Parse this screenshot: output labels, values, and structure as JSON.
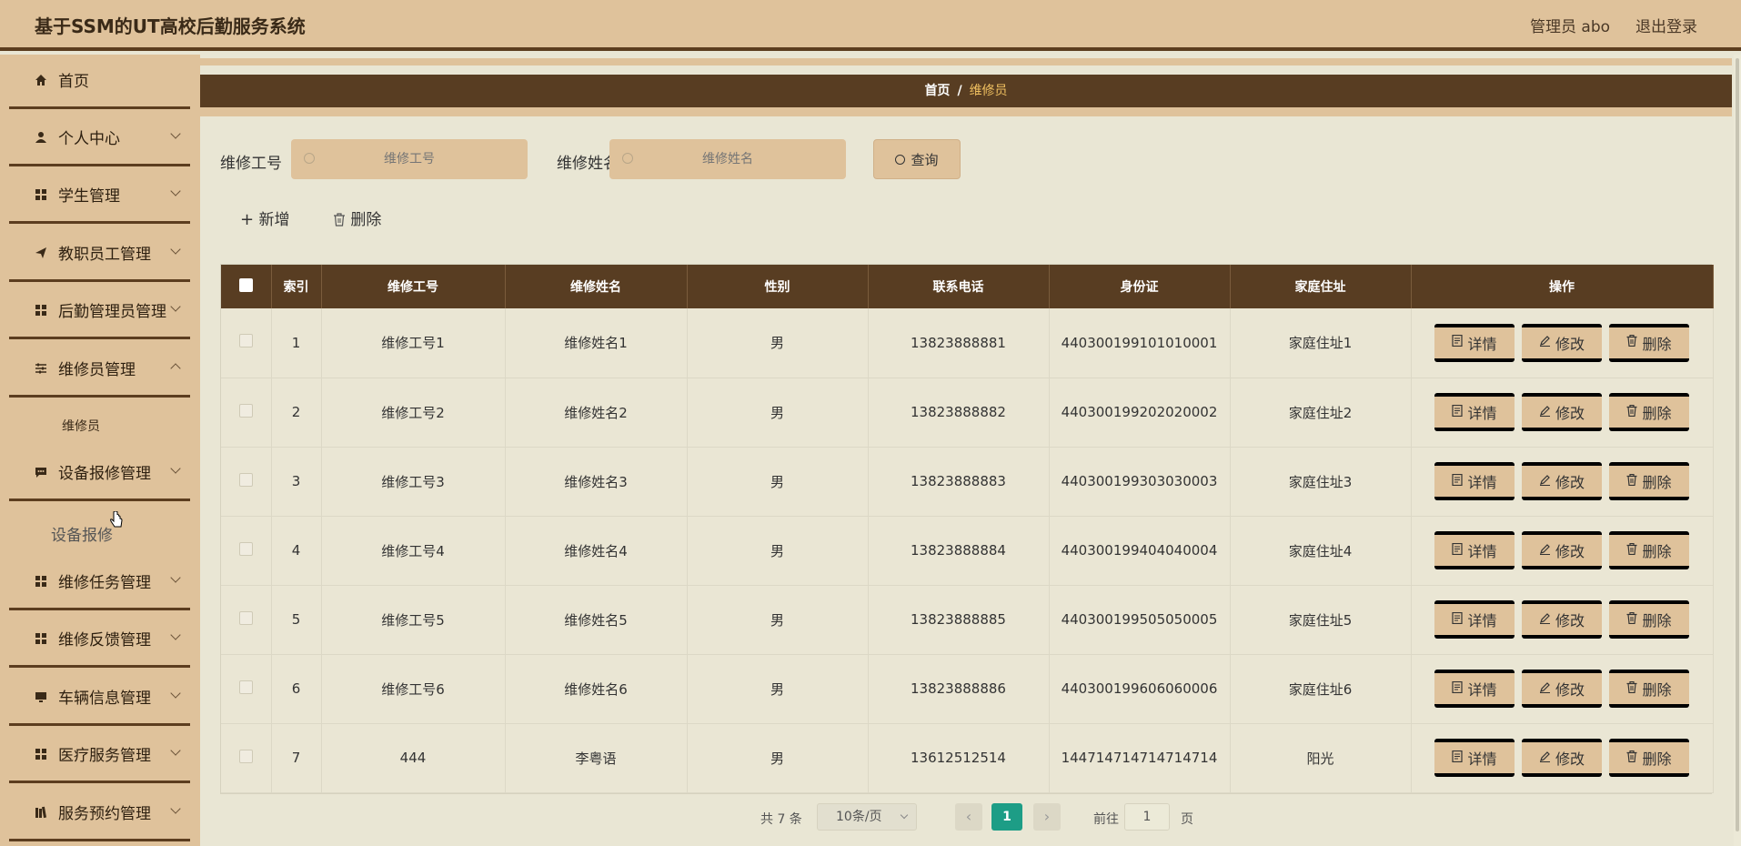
{
  "header": {
    "title": "基于SSM的UT高校后勤服务系统",
    "user": "管理员 abo",
    "logout": "退出登录"
  },
  "sidebar": {
    "items": [
      {
        "label": "首页",
        "icon": "home-icon"
      },
      {
        "label": "个人中心",
        "icon": "user-icon"
      },
      {
        "label": "学生管理",
        "icon": "grid-icon"
      },
      {
        "label": "教职员工管理",
        "icon": "send-icon"
      },
      {
        "label": "后勤管理员管理",
        "icon": "grid-icon"
      },
      {
        "label": "维修员管理",
        "icon": "sliders-icon"
      },
      {
        "label": "设备报修管理",
        "icon": "chat-icon"
      },
      {
        "label": "维修任务管理",
        "icon": "grid-icon"
      },
      {
        "label": "维修反馈管理",
        "icon": "grid-icon"
      },
      {
        "label": "车辆信息管理",
        "icon": "monitor-icon"
      },
      {
        "label": "医疗服务管理",
        "icon": "grid-icon"
      },
      {
        "label": "服务预约管理",
        "icon": "books-icon"
      }
    ],
    "sub_repairman": "维修员",
    "sub_equipment": "设备报修"
  },
  "breadcrumb": {
    "home": "首页",
    "sep": "/",
    "current": "维修员"
  },
  "search": {
    "label1": "维修工号",
    "placeholder1": "维修工号",
    "label2": "维修姓名",
    "placeholder2": "维修姓名",
    "button": "查询"
  },
  "actions": {
    "add": "新增",
    "delete": "删除"
  },
  "table": {
    "headers": [
      "索引",
      "维修工号",
      "维修姓名",
      "性别",
      "联系电话",
      "身份证",
      "家庭住址",
      "操作"
    ],
    "rows": [
      [
        "1",
        "维修工号1",
        "维修姓名1",
        "男",
        "13823888881",
        "440300199101010001",
        "家庭住址1"
      ],
      [
        "2",
        "维修工号2",
        "维修姓名2",
        "男",
        "13823888882",
        "440300199202020002",
        "家庭住址2"
      ],
      [
        "3",
        "维修工号3",
        "维修姓名3",
        "男",
        "13823888883",
        "440300199303030003",
        "家庭住址3"
      ],
      [
        "4",
        "维修工号4",
        "维修姓名4",
        "男",
        "13823888884",
        "440300199404040004",
        "家庭住址4"
      ],
      [
        "5",
        "维修工号5",
        "维修姓名5",
        "男",
        "13823888885",
        "440300199505050005",
        "家庭住址5"
      ],
      [
        "6",
        "维修工号6",
        "维修姓名6",
        "男",
        "13823888886",
        "440300199606060006",
        "家庭住址6"
      ],
      [
        "7",
        "444",
        "李粤语",
        "男",
        "13612512514",
        "144714714714714714",
        "阳光"
      ]
    ],
    "op_detail": "详情",
    "op_edit": "修改",
    "op_delete": "删除"
  },
  "pagination": {
    "total": "共 7 条",
    "page_size": "10条/页",
    "current_page": "1",
    "goto_label": "前往",
    "goto_value": "1",
    "page_suffix": "页"
  },
  "colors": {
    "header_bg": "#dfc29b",
    "dark_brown": "#583d22",
    "accent_gold": "#f0c060",
    "page_active": "#1d9d86"
  }
}
